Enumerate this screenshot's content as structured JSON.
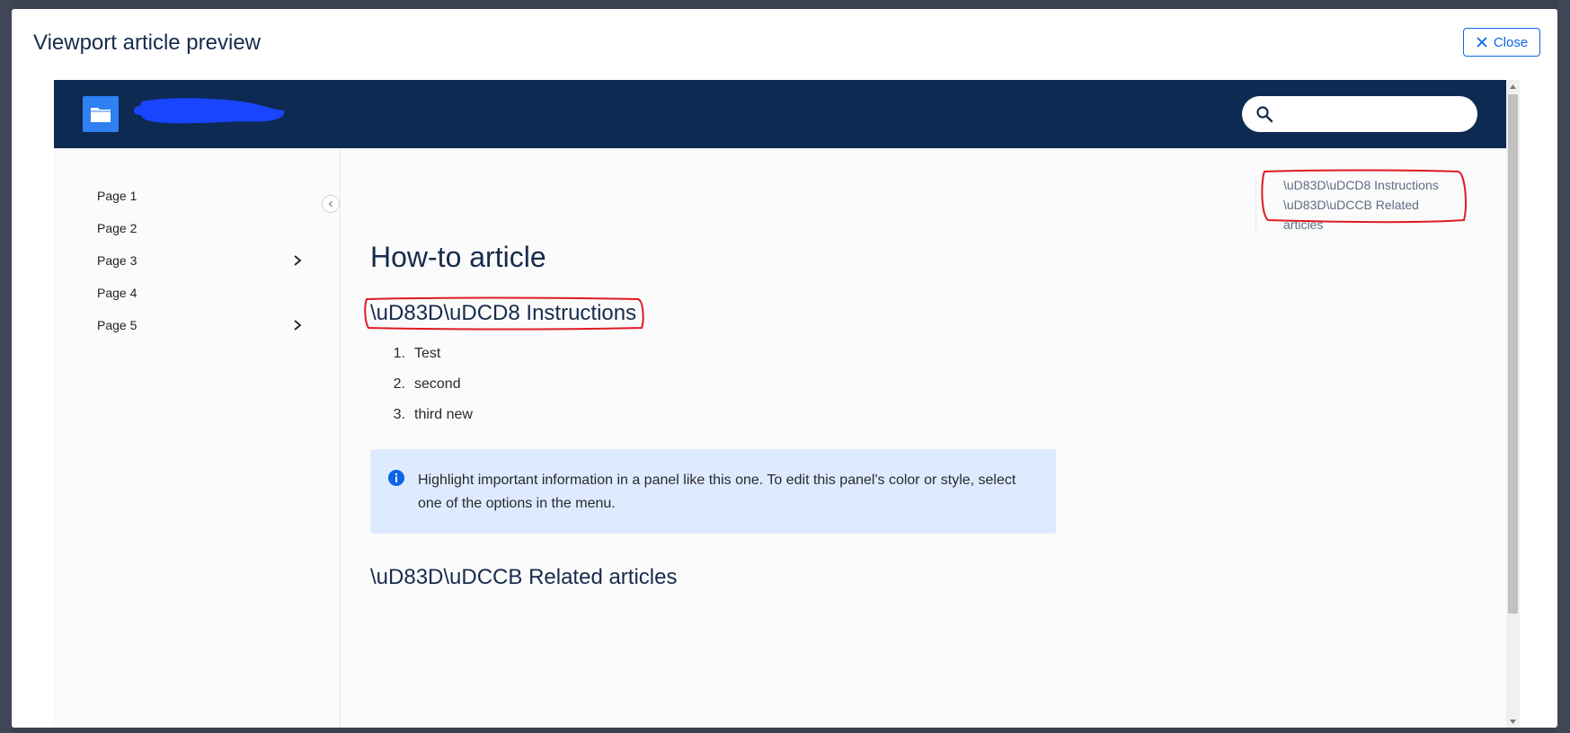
{
  "modal": {
    "title": "Viewport article preview",
    "close_label": "Close"
  },
  "nav": {
    "items": [
      {
        "label": "Page 1",
        "expandable": false
      },
      {
        "label": "Page 2",
        "expandable": false
      },
      {
        "label": "Page 3",
        "expandable": true
      },
      {
        "label": "Page 4",
        "expandable": false
      },
      {
        "label": "Page 5",
        "expandable": true
      }
    ]
  },
  "article": {
    "title": "How-to article",
    "instructions_heading": "\\uD83D\\uDCD8 Instructions",
    "steps": [
      {
        "num": "1.",
        "text": "Test"
      },
      {
        "num": "2.",
        "text": "second"
      },
      {
        "num": "3.",
        "text": "third new"
      }
    ],
    "panel_text": "Highlight important information in a panel like this one. To edit this panel's color or style, select one of the options in the menu.",
    "related_heading": "\\uD83D\\uDCCB Related articles"
  },
  "toc": {
    "items": [
      "\\uD83D\\uDCD8 Instructions",
      "\\uD83D\\uDCCB Related articles"
    ]
  },
  "colors": {
    "header_bg": "#0d2a52",
    "accent": "#0c66e4",
    "logo": "#2f80f1",
    "panel_bg": "#deebfe",
    "annotation": "#e01b24",
    "redaction": "#1a45ff"
  },
  "icons": [
    "close-icon",
    "folder-icon",
    "search-icon",
    "chevron-right-icon",
    "chevron-left-icon",
    "info-icon"
  ]
}
